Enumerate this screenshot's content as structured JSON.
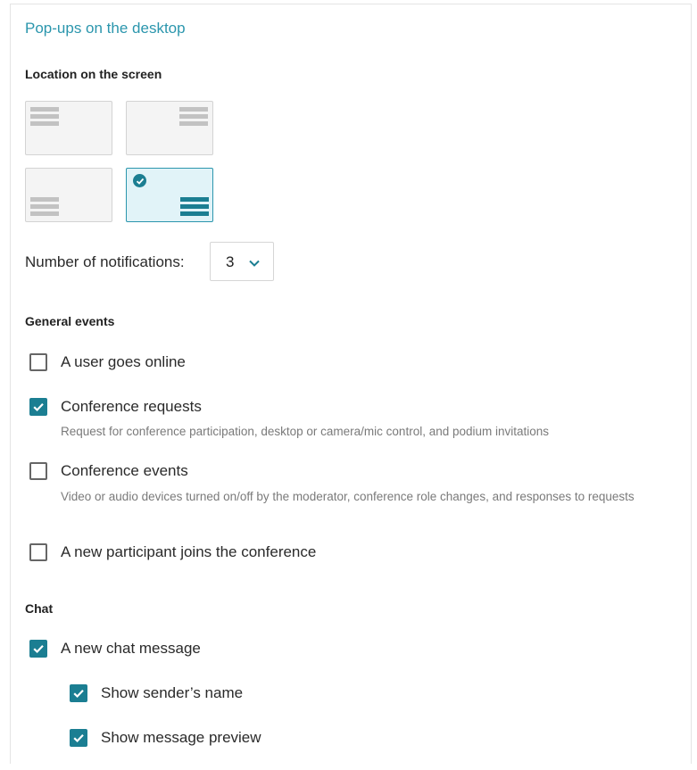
{
  "title": "Pop-ups on the desktop",
  "location": {
    "heading": "Location on the screen",
    "positions": [
      "top-left",
      "top-right",
      "bottom-left",
      "bottom-right"
    ],
    "selected": "bottom-right",
    "accent_color": "#1b7e92"
  },
  "notifications": {
    "label": "Number of notifications:",
    "value": "3",
    "icon": "chevron-down-icon"
  },
  "general_events": {
    "heading": "General events",
    "items": [
      {
        "label": "A user goes online",
        "checked": false
      },
      {
        "label": "Conference requests",
        "checked": true,
        "description": "Request for conference participation, desktop or camera/mic control, and podium invitations"
      },
      {
        "label": "Conference events",
        "checked": false,
        "description": "Video or audio devices turned on/off by the moderator, conference role changes, and responses to requests"
      },
      {
        "label": "A new participant joins the conference",
        "checked": false
      }
    ]
  },
  "chat": {
    "heading": "Chat",
    "new_message": {
      "label": "A new chat message",
      "checked": true
    },
    "sub_items": [
      {
        "label": "Show sender’s name",
        "checked": true
      },
      {
        "label": "Show message preview",
        "checked": true
      }
    ]
  }
}
